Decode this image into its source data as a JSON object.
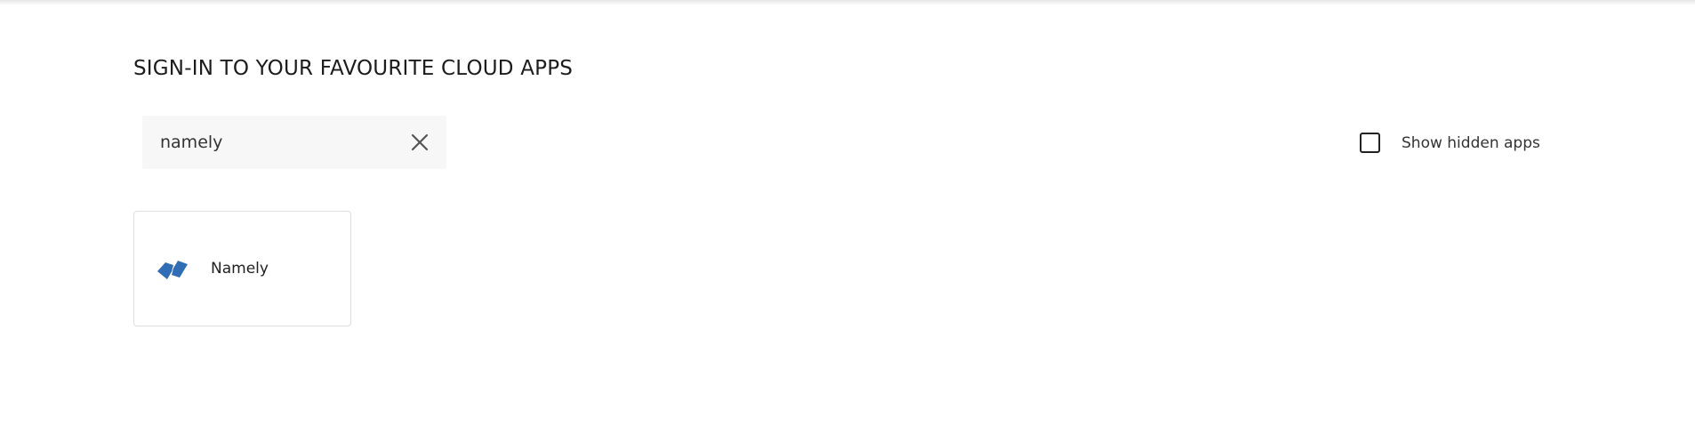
{
  "header": {
    "title": "SIGN-IN TO YOUR FAVOURITE CLOUD APPS"
  },
  "search": {
    "value": "namely",
    "clear_icon": "close-icon"
  },
  "filters": {
    "show_hidden_label": "Show hidden apps",
    "show_hidden_checked": false
  },
  "apps": [
    {
      "name": "Namely",
      "logo_icon": "namely-logo-icon",
      "logo_color": "#2f6db5"
    }
  ],
  "colors": {
    "search_background": "#f7f7f7",
    "card_border": "#dedede"
  }
}
